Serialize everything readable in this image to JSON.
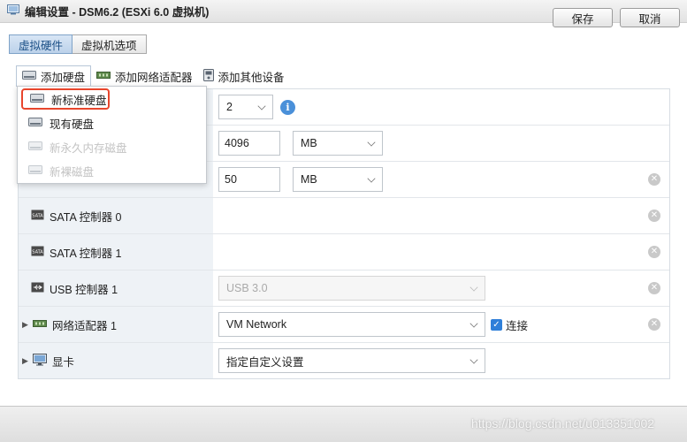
{
  "window": {
    "title": "编辑设置 - DSM6.2 (ESXi 6.0 虚拟机)"
  },
  "tabs": [
    {
      "label": "虚拟硬件",
      "active": true
    },
    {
      "label": "虚拟机选项",
      "active": false
    }
  ],
  "toolbar": {
    "add_disk": "添加硬盘",
    "add_nic": "添加网络适配器",
    "add_other": "添加其他设备"
  },
  "dropdown": {
    "items": [
      {
        "label": "新标准硬盘",
        "enabled": true,
        "highlighted": true
      },
      {
        "label": "现有硬盘",
        "enabled": true
      },
      {
        "label": "新永久内存磁盘",
        "enabled": false
      },
      {
        "label": "新裸磁盘",
        "enabled": false
      }
    ]
  },
  "rows": {
    "cpu": {
      "value": "2"
    },
    "memory": {
      "value": "4096",
      "unit": "MB"
    },
    "disk": {
      "value": "50",
      "unit": "MB"
    },
    "sata0": {
      "label": "SATA 控制器 0"
    },
    "sata1": {
      "label": "SATA 控制器 1"
    },
    "usb": {
      "label": "USB 控制器 1",
      "value": "USB 3.0"
    },
    "nic": {
      "label": "网络适配器 1",
      "value": "VM Network",
      "connect_label": "连接"
    },
    "video": {
      "label": "显卡",
      "value": "指定自定义设置"
    }
  },
  "footer": {
    "save": "保存",
    "cancel": "取消"
  },
  "watermark": "https://blog.csdn.net/u013351002",
  "colors": {
    "accent": "#4a90d9",
    "highlight_border": "#e8452c"
  }
}
